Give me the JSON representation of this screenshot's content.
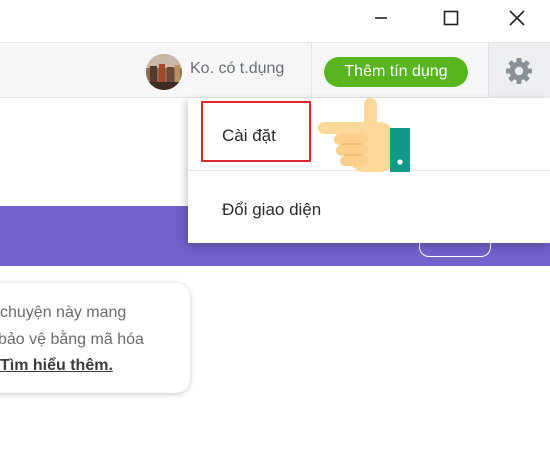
{
  "titlebar": {
    "minimize_icon": "minimize-icon",
    "maximize_icon": "maximize-icon",
    "close_icon": "close-icon"
  },
  "toolbar": {
    "account_label": "Ko. có t.dụng",
    "credit_button_label": "Thêm tín dụng",
    "settings_icon": "gear-icon"
  },
  "dropdown": {
    "items": [
      {
        "label": "Cài đặt"
      },
      {
        "label": "Đổi giao diện"
      }
    ]
  },
  "notice": {
    "line1": "chuyện này mang",
    "line2": "bảo vệ bằng mã hóa",
    "link": "Tìm hiểu thêm."
  },
  "colors": {
    "accent_green": "#58b51e",
    "banner_purple": "#7460ca",
    "highlight_red": "#d72a2f"
  }
}
